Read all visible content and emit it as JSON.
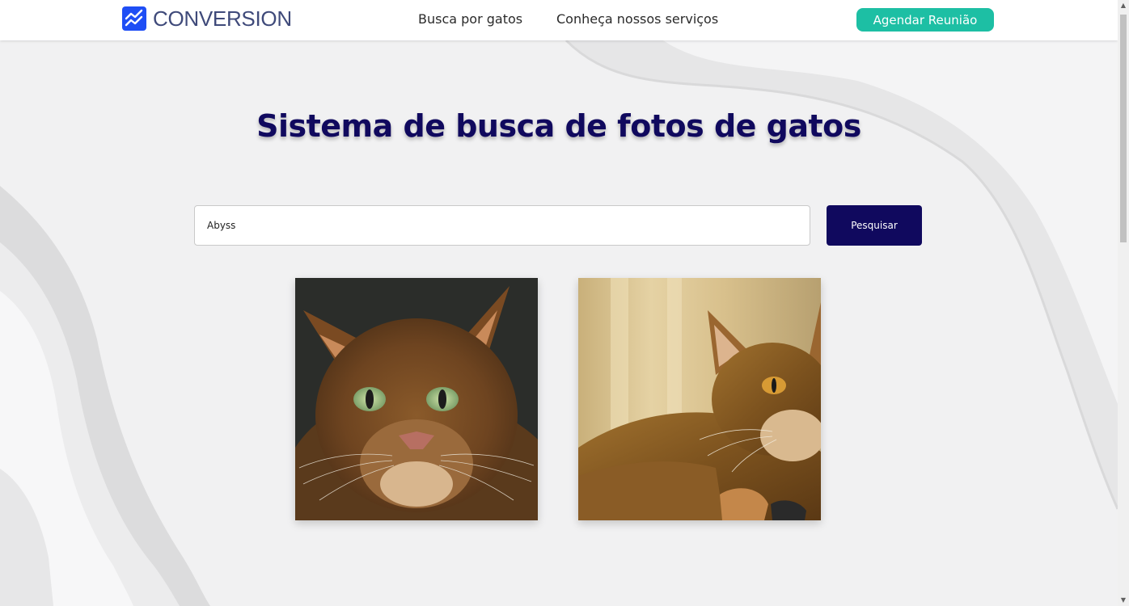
{
  "header": {
    "brand": "CONVERSION",
    "nav": [
      {
        "label": "Busca por gatos"
      },
      {
        "label": "Conheça nossos serviços"
      }
    ],
    "cta_label": "Agendar Reunião"
  },
  "main": {
    "title": "Sistema de busca de fotos de gatos",
    "search": {
      "value": "Abyss",
      "button_label": "Pesquisar"
    },
    "results": [
      {
        "alt": "Abyssinian cat portrait with green eyes"
      },
      {
        "alt": "Abyssinian cat lying down in sunlight"
      }
    ]
  },
  "colors": {
    "brand_navy": "#10095e",
    "accent_teal": "#1dbfa4",
    "logo_blue": "#1f4ef5",
    "background": "#f1f1f2"
  },
  "icons": {
    "logo": "chart-trend-icon",
    "scroll_up": "chevron-up-icon",
    "scroll_down": "chevron-down-icon"
  }
}
